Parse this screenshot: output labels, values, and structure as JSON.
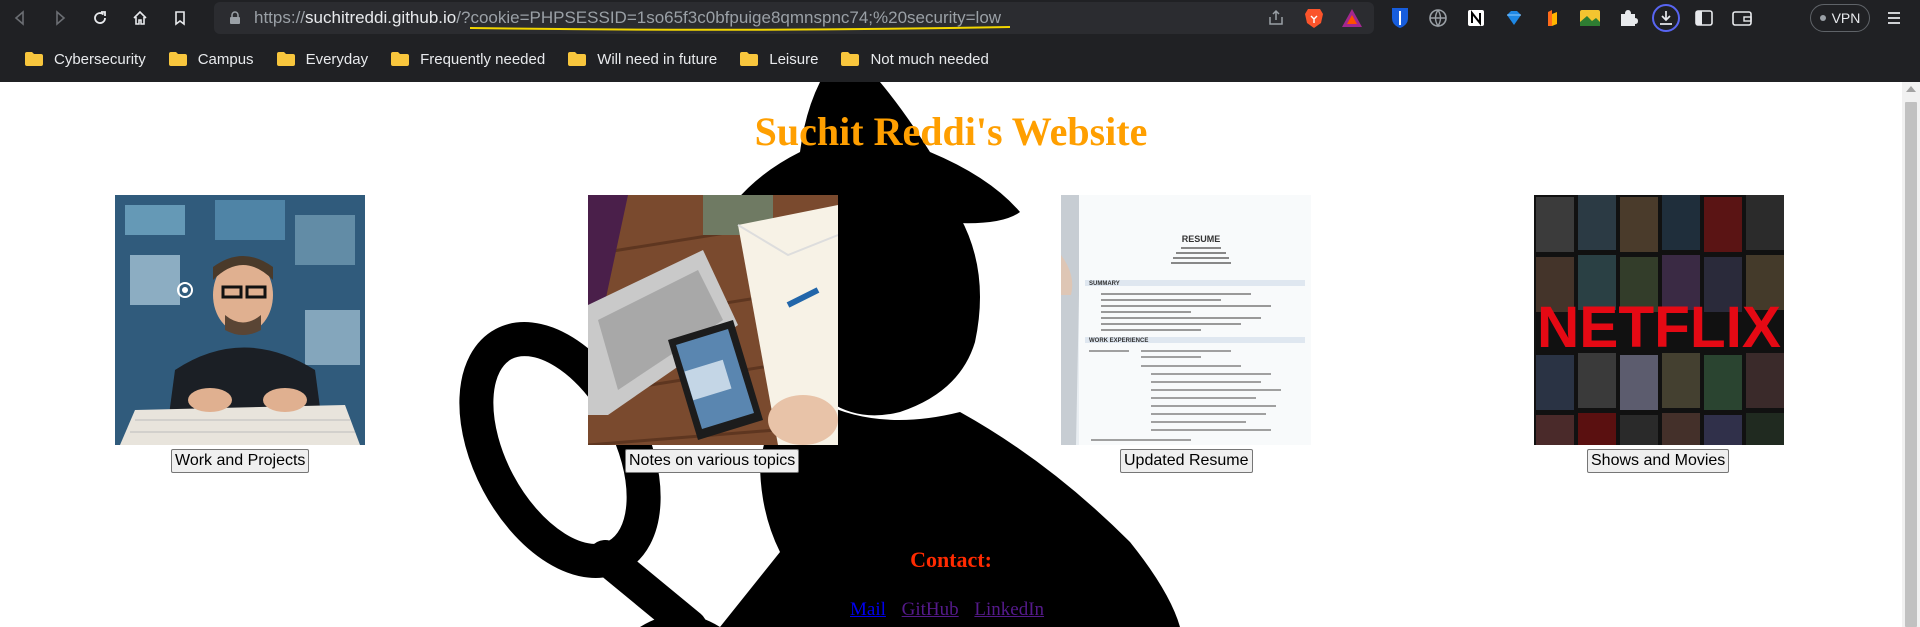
{
  "browser": {
    "url_scheme": "https://",
    "url_host": "suchitreddi.github.io",
    "url_path": "/?",
    "url_query": "cookie=PHPSESSID=1so65f3c0bfpuige8qmnspnc74;%20security=low",
    "vpn_label": "VPN"
  },
  "bookmarks": [
    {
      "label": "Cybersecurity"
    },
    {
      "label": "Campus"
    },
    {
      "label": "Everyday"
    },
    {
      "label": "Frequently needed"
    },
    {
      "label": "Will need in future"
    },
    {
      "label": "Leisure"
    },
    {
      "label": "Not much needed"
    }
  ],
  "page": {
    "title": "Suchit Reddi's Website",
    "cards": [
      {
        "button": "Work and Projects",
        "image": "hacker-at-keyboard"
      },
      {
        "button": "Notes on various topics",
        "image": "laptop-notebook-phone"
      },
      {
        "button": "Updated Resume",
        "image": "resume-document"
      },
      {
        "button": "Shows and Movies",
        "image": "netflix-poster-collage"
      }
    ],
    "contact_heading": "Contact:",
    "links": [
      {
        "label": "Mail",
        "visited": false
      },
      {
        "label": "GitHub",
        "visited": true
      },
      {
        "label": "LinkedIn",
        "visited": true
      }
    ],
    "resume_thumb": {
      "heading": "RESUME",
      "summary": "SUMMARY",
      "experience": "WORK EXPERIENCE"
    },
    "netflix_logo": "NETFLIX"
  },
  "colors": {
    "title": "#ff9f00",
    "contact": "#ff2a00",
    "chrome_bg": "#202124",
    "underline_annotation": "#f2d600"
  }
}
